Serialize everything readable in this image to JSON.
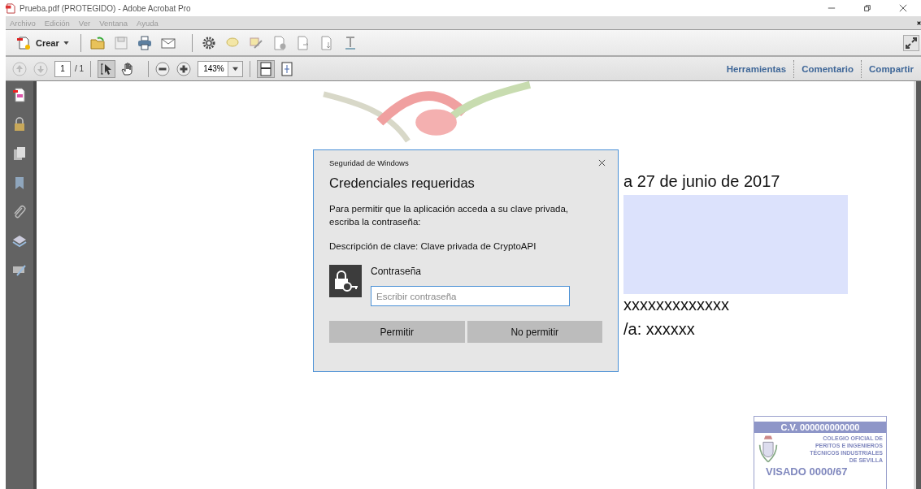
{
  "window": {
    "title": "Prueba.pdf (PROTEGIDO) - Adobe Acrobat Pro"
  },
  "menu": [
    {
      "label": "Archivo",
      "disabled": true
    },
    {
      "label": "Edición",
      "disabled": true
    },
    {
      "label": "Ver",
      "disabled": true
    },
    {
      "label": "Ventana",
      "disabled": true
    },
    {
      "label": "Ayuda",
      "disabled": true
    }
  ],
  "toolbar": {
    "create_label": "Crear"
  },
  "navigation": {
    "page": "1",
    "page_total": "/ 1",
    "zoom": "143%"
  },
  "panels": [
    "Herramientas",
    "Comentario",
    "Compartir"
  ],
  "document": {
    "date_line": "a 27 de junio de 2017",
    "line_1": "xxxxxxxxxxxxx",
    "line_2": "/a: xxxxxx",
    "stamp": {
      "header": "C.V. 000000000000",
      "org_lines": [
        "COLEGIO OFICIAL DE",
        "PERITOS E INGENIEROS",
        "TÉCNICOS INDUSTRIALES",
        "DE SEVILLA"
      ],
      "visado": "VISADO 0000/67"
    }
  },
  "dialog": {
    "caption": "Seguridad de Windows",
    "heading": "Credenciales requeridas",
    "message": "Para permitir que la aplicación acceda a su clave privada, escriba la contraseña:",
    "key_description": "Descripción de clave: Clave privada de CryptoAPI",
    "field_label": "Contraseña",
    "placeholder": "Escribir contraseña",
    "buttons": [
      "Permitir",
      "No permitir"
    ]
  }
}
